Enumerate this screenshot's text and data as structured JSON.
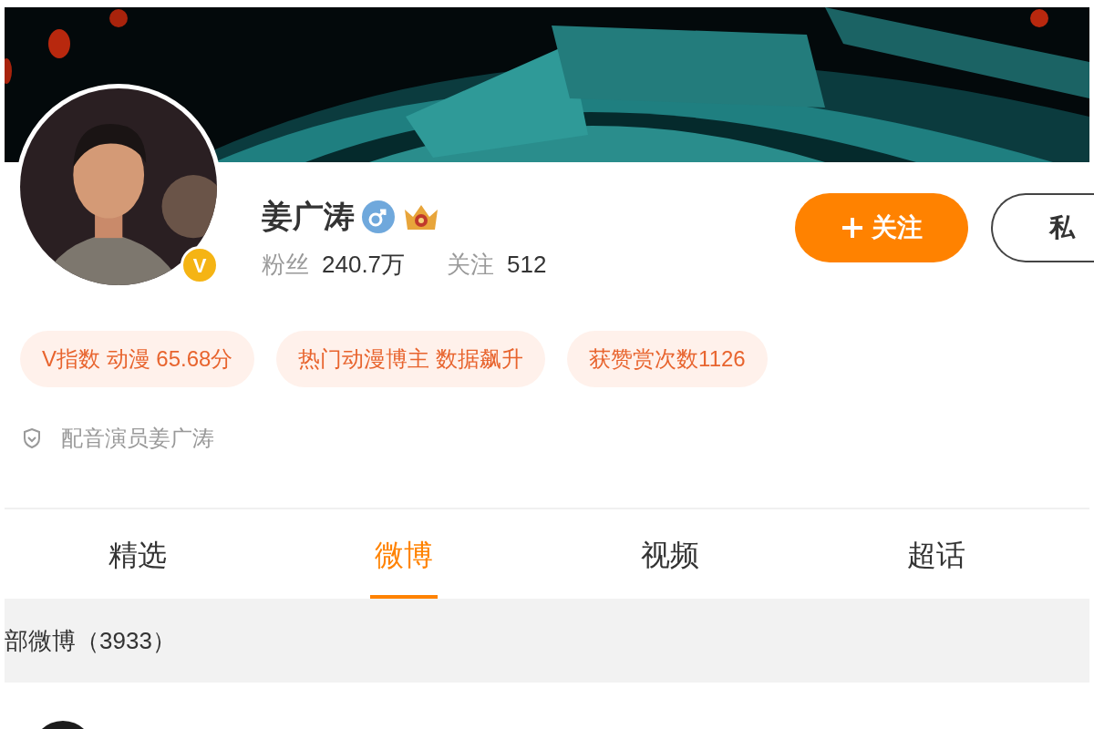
{
  "profile": {
    "name": "姜广涛",
    "verified_badge": "V",
    "followers_label": "粉丝",
    "followers": "240.7万",
    "following_label": "关注",
    "following": "512"
  },
  "actions": {
    "follow": "关注",
    "message": "私"
  },
  "tags": [
    "V指数 动漫 65.68分",
    "热门动漫博主 数据飙升",
    "获赞赏次数1126"
  ],
  "description": "配音演员姜广涛",
  "tabs": [
    {
      "label": "精选",
      "selected": false
    },
    {
      "label": "微博",
      "selected": true
    },
    {
      "label": "视频",
      "selected": false
    },
    {
      "label": "超话",
      "selected": false
    }
  ],
  "feed_header": "部微博（3933）"
}
